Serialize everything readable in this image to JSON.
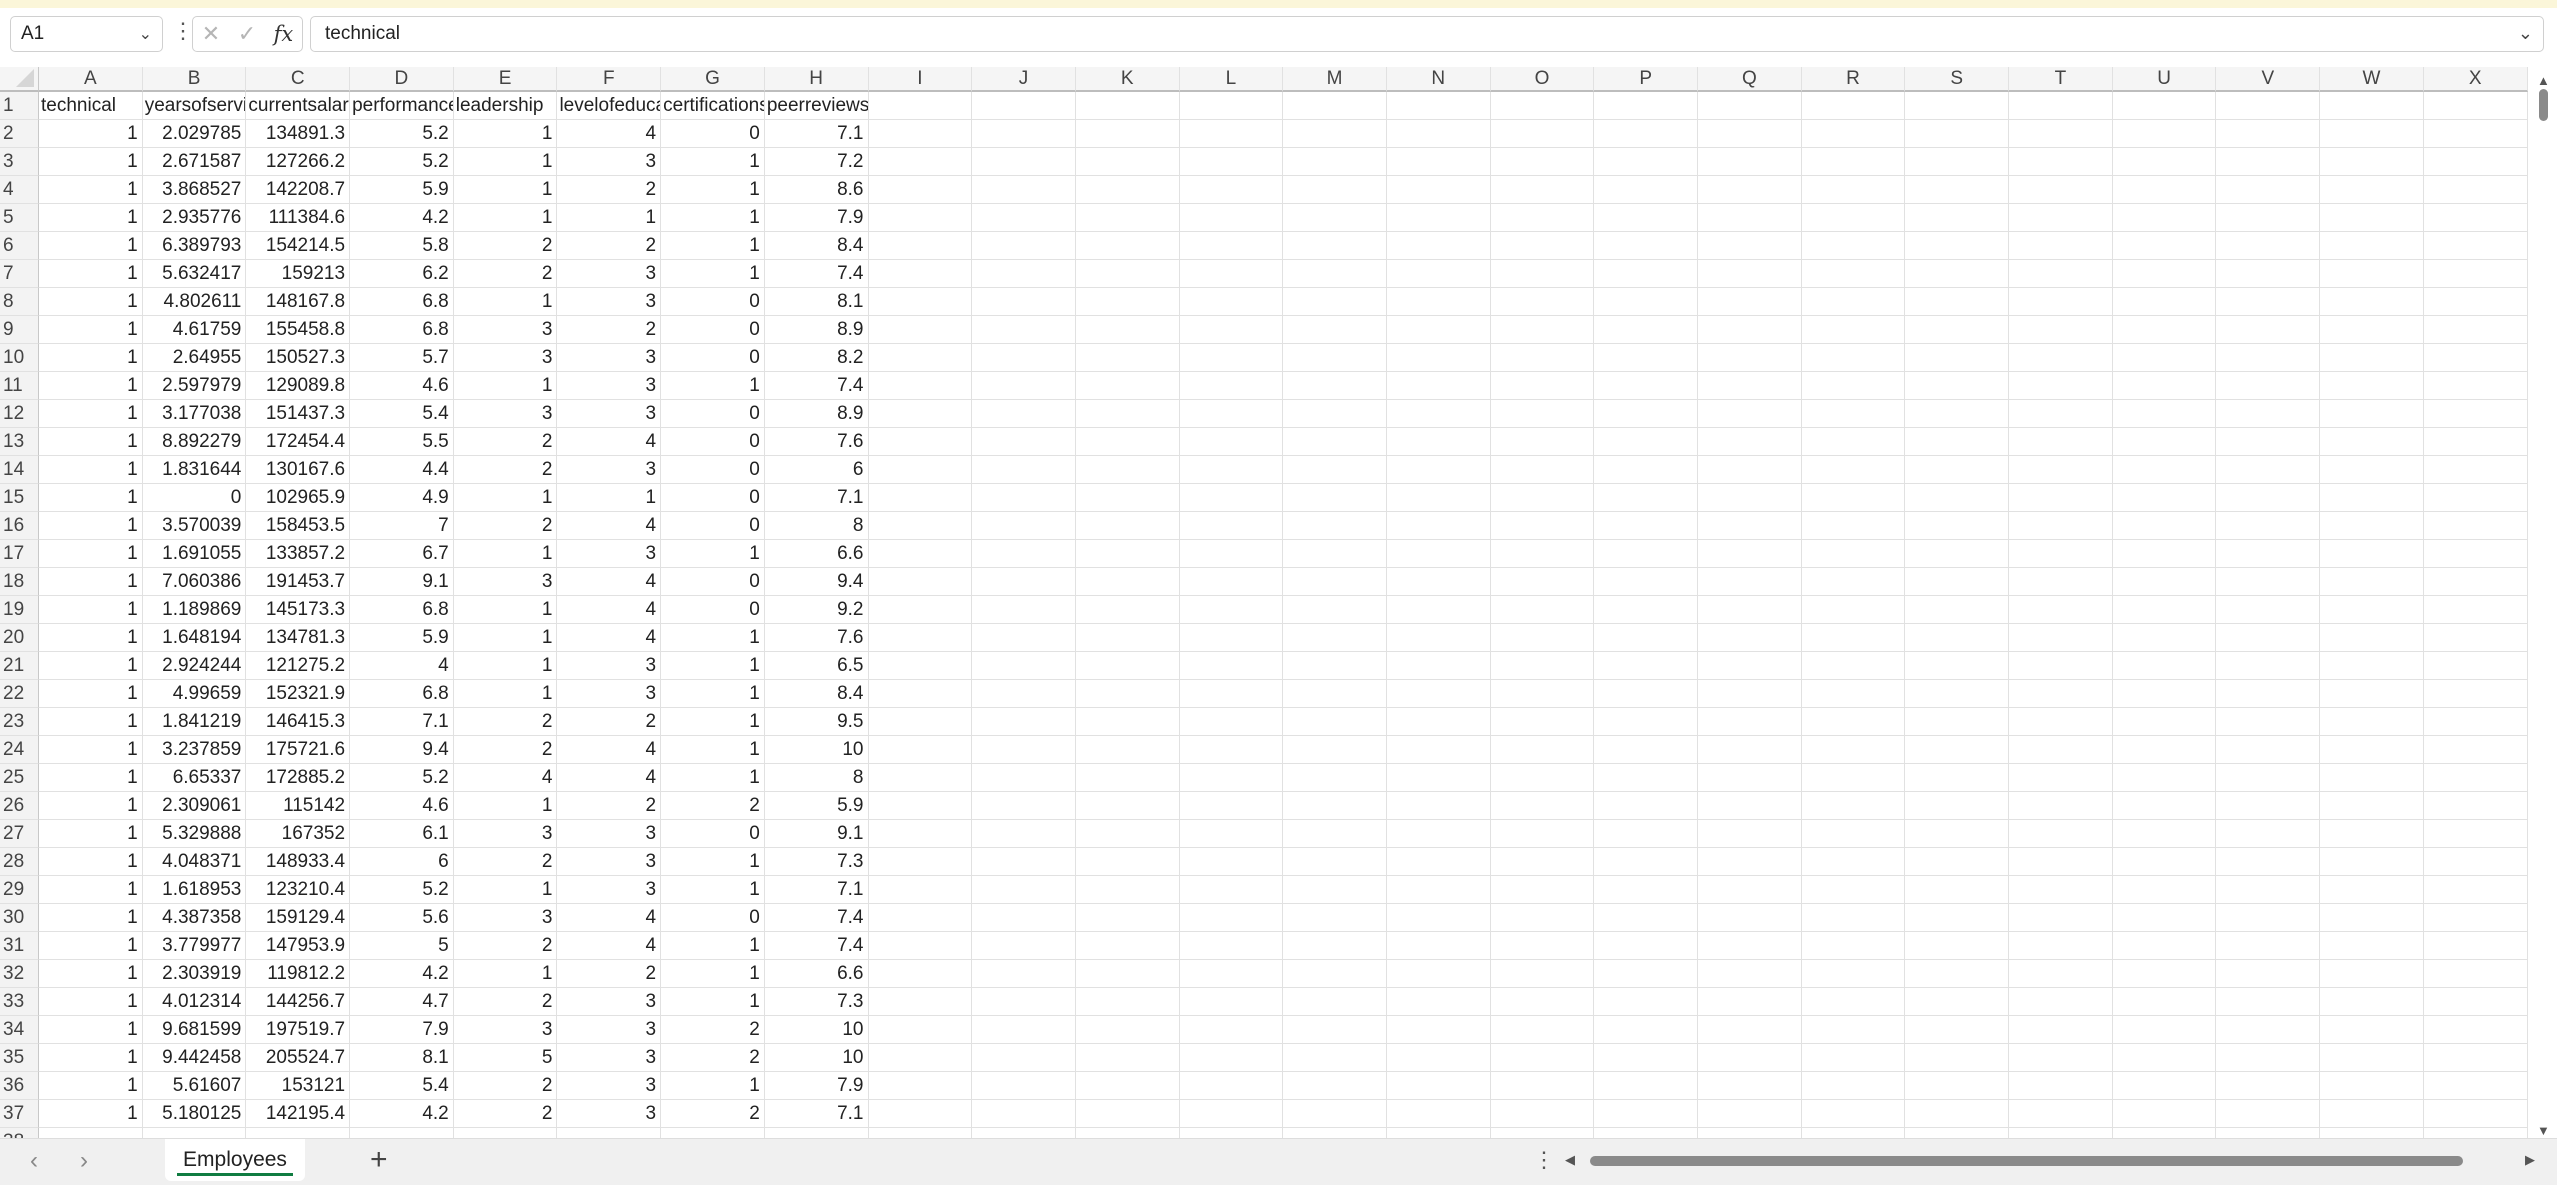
{
  "formula_bar": {
    "name_box": "A1",
    "cancel_icon": "✕",
    "enter_icon": "✓",
    "fx_label": "fx",
    "formula_value": "technical"
  },
  "sheet": {
    "columns": [
      "A",
      "B",
      "C",
      "D",
      "E",
      "F",
      "G",
      "H",
      "I",
      "J",
      "K",
      "L",
      "M",
      "N",
      "O",
      "P",
      "Q",
      "R",
      "S",
      "T",
      "U",
      "V",
      "W",
      "X"
    ],
    "headers": [
      "technical",
      "yearsofservice",
      "currentsalary",
      "performance",
      "leadership",
      "levelofeducation",
      "certifications",
      "peerreviews"
    ],
    "rows": [
      [
        "1",
        "2.029785",
        "134891.3",
        "5.2",
        "1",
        "4",
        "0",
        "7.1"
      ],
      [
        "1",
        "2.671587",
        "127266.2",
        "5.2",
        "1",
        "3",
        "1",
        "7.2"
      ],
      [
        "1",
        "3.868527",
        "142208.7",
        "5.9",
        "1",
        "2",
        "1",
        "8.6"
      ],
      [
        "1",
        "2.935776",
        "111384.6",
        "4.2",
        "1",
        "1",
        "1",
        "7.9"
      ],
      [
        "1",
        "6.389793",
        "154214.5",
        "5.8",
        "2",
        "2",
        "1",
        "8.4"
      ],
      [
        "1",
        "5.632417",
        "159213",
        "6.2",
        "2",
        "3",
        "1",
        "7.4"
      ],
      [
        "1",
        "4.802611",
        "148167.8",
        "6.8",
        "1",
        "3",
        "0",
        "8.1"
      ],
      [
        "1",
        "4.61759",
        "155458.8",
        "6.8",
        "3",
        "2",
        "0",
        "8.9"
      ],
      [
        "1",
        "2.64955",
        "150527.3",
        "5.7",
        "3",
        "3",
        "0",
        "8.2"
      ],
      [
        "1",
        "2.597979",
        "129089.8",
        "4.6",
        "1",
        "3",
        "1",
        "7.4"
      ],
      [
        "1",
        "3.177038",
        "151437.3",
        "5.4",
        "3",
        "3",
        "0",
        "8.9"
      ],
      [
        "1",
        "8.892279",
        "172454.4",
        "5.5",
        "2",
        "4",
        "0",
        "7.6"
      ],
      [
        "1",
        "1.831644",
        "130167.6",
        "4.4",
        "2",
        "3",
        "0",
        "6"
      ],
      [
        "1",
        "0",
        "102965.9",
        "4.9",
        "1",
        "1",
        "0",
        "7.1"
      ],
      [
        "1",
        "3.570039",
        "158453.5",
        "7",
        "2",
        "4",
        "0",
        "8"
      ],
      [
        "1",
        "1.691055",
        "133857.2",
        "6.7",
        "1",
        "3",
        "1",
        "6.6"
      ],
      [
        "1",
        "7.060386",
        "191453.7",
        "9.1",
        "3",
        "4",
        "0",
        "9.4"
      ],
      [
        "1",
        "1.189869",
        "145173.3",
        "6.8",
        "1",
        "4",
        "0",
        "9.2"
      ],
      [
        "1",
        "1.648194",
        "134781.3",
        "5.9",
        "1",
        "4",
        "1",
        "7.6"
      ],
      [
        "1",
        "2.924244",
        "121275.2",
        "4",
        "1",
        "3",
        "1",
        "6.5"
      ],
      [
        "1",
        "4.99659",
        "152321.9",
        "6.8",
        "1",
        "3",
        "1",
        "8.4"
      ],
      [
        "1",
        "1.841219",
        "146415.3",
        "7.1",
        "2",
        "2",
        "1",
        "9.5"
      ],
      [
        "1",
        "3.237859",
        "175721.6",
        "9.4",
        "2",
        "4",
        "1",
        "10"
      ],
      [
        "1",
        "6.65337",
        "172885.2",
        "5.2",
        "4",
        "4",
        "1",
        "8"
      ],
      [
        "1",
        "2.309061",
        "115142",
        "4.6",
        "1",
        "2",
        "2",
        "5.9"
      ],
      [
        "1",
        "5.329888",
        "167352",
        "6.1",
        "3",
        "3",
        "0",
        "9.1"
      ],
      [
        "1",
        "4.048371",
        "148933.4",
        "6",
        "2",
        "3",
        "1",
        "7.3"
      ],
      [
        "1",
        "1.618953",
        "123210.4",
        "5.2",
        "1",
        "3",
        "1",
        "7.1"
      ],
      [
        "1",
        "4.387358",
        "159129.4",
        "5.6",
        "3",
        "4",
        "0",
        "7.4"
      ],
      [
        "1",
        "3.779977",
        "147953.9",
        "5",
        "2",
        "4",
        "1",
        "7.4"
      ],
      [
        "1",
        "2.303919",
        "119812.2",
        "4.2",
        "1",
        "2",
        "1",
        "6.6"
      ],
      [
        "1",
        "4.012314",
        "144256.7",
        "4.7",
        "2",
        "3",
        "1",
        "7.3"
      ],
      [
        "1",
        "9.681599",
        "197519.7",
        "7.9",
        "3",
        "3",
        "2",
        "10"
      ],
      [
        "1",
        "9.442458",
        "205524.7",
        "8.1",
        "5",
        "3",
        "2",
        "10"
      ],
      [
        "1",
        "5.61607",
        "153121",
        "5.4",
        "2",
        "3",
        "1",
        "7.9"
      ],
      [
        "1",
        "5.180125",
        "142195.4",
        "4.2",
        "2",
        "3",
        "2",
        "7.1"
      ]
    ]
  },
  "tabs": {
    "sheets": [
      "Employees"
    ],
    "active": "Employees",
    "add_label": "+",
    "accent_color": "#107c41"
  }
}
